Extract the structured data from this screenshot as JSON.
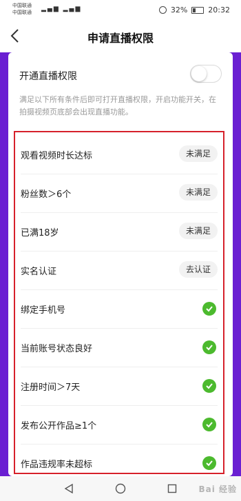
{
  "status_bar": {
    "carrier1": "中国联通",
    "carrier2": "中国联通",
    "signal_text": "▂▄▆ ▂▄▆",
    "battery": "32%",
    "time": "20:32"
  },
  "header": {
    "title": "申请直播权限",
    "back_icon": "chevron-left-icon"
  },
  "settings": {
    "toggle_label": "开通直播权限",
    "toggle_on": false,
    "description": "满足以下所有条件后即可打开直播权限，开启功能开关，在拍摄视频页底部会出现直播功能。"
  },
  "requirements": [
    {
      "label": "观看视频时长达标",
      "status": "未满足",
      "type": "badge"
    },
    {
      "label": "粉丝数＞6个",
      "status": "未满足",
      "type": "badge"
    },
    {
      "label": "已满18岁",
      "status": "未满足",
      "type": "badge"
    },
    {
      "label": "实名认证",
      "status": "去认证",
      "type": "badge"
    },
    {
      "label": "绑定手机号",
      "type": "check"
    },
    {
      "label": "当前账号状态良好",
      "type": "check"
    },
    {
      "label": "注册时间＞7天",
      "type": "check"
    },
    {
      "label": "发布公开作品≥1个",
      "type": "check"
    },
    {
      "label": "作品违规率未超标",
      "type": "check"
    }
  ],
  "nav_bar": {
    "back": "triangle-back-icon",
    "home": "circle-home-icon",
    "recent": "square-recent-icon"
  },
  "watermark": "Bai 经验",
  "colors": {
    "accent_purple": "#6a1fd2",
    "check_green": "#4cba2e",
    "highlight_red": "#d6202a"
  }
}
